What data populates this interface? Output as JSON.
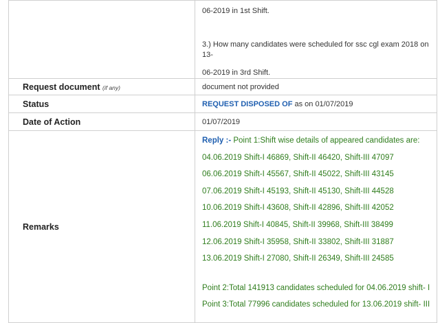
{
  "top_row": {
    "line1": "06-2019 in 1st Shift.",
    "line2": "3.) How many candidates were scheduled for ssc cgl exam 2018 on 13-",
    "line3": "06-2019 in 3rd Shift."
  },
  "request_document": {
    "label": "Request document",
    "hint": "(if any)",
    "value": "document not provided"
  },
  "status": {
    "label": "Status",
    "value_strong": "REQUEST DISPOSED OF",
    "value_rest": " as on 01/07/2019"
  },
  "date_of_action": {
    "label": "Date of Action",
    "value": "01/07/2019"
  },
  "remarks": {
    "label": "Remarks",
    "reply_label": "Reply :-",
    "reply_intro": " Point 1:Shift wise details of appeared candidates are:",
    "rows": [
      "04.06.2019 Shift-I 46869, Shift-II 46420, Shift-III 47097",
      "06.06.2019 Shift-I 45567, Shift-II 45022, Shift-III 43145",
      "07.06.2019 Shift-I 45193, Shift-II 45130, Shift-III 44528",
      "10.06.2019 Shift-I 43608, Shift-II 42896, Shift-III 42052",
      "11.06.2019 Shift-I 40845, Shift-II 39968, Shift-III 38499",
      "12.06.2019 Shift-I 35958, Shift-II 33802, Shift-III 31887",
      "13.06.2019 Shift-I 27080, Shift-II 26349, Shift-III 24585"
    ],
    "point2": "Point 2:Total 141913 candidates scheduled for 04.06.2019 shift- I",
    "point3": "Point 3:Total 77996 candidates scheduled for 13.06.2019 shift- III"
  },
  "colors": {
    "reply_blue": "#1f5fb0",
    "answer_green": "#2f7d1d",
    "border": "#cfcfcf"
  }
}
